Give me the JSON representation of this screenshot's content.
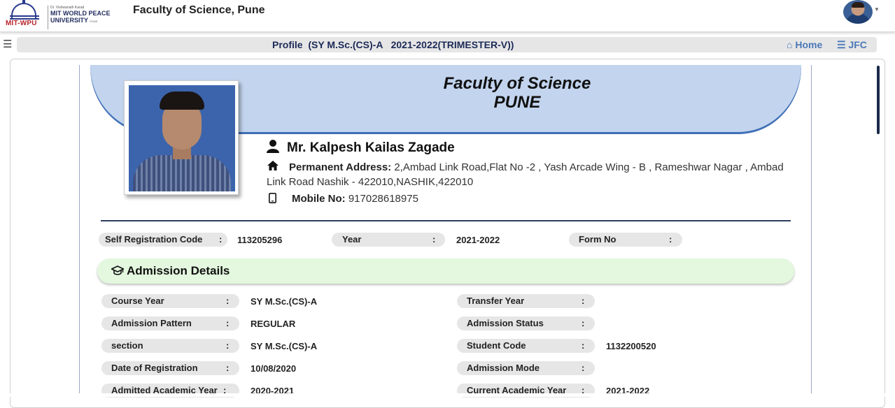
{
  "header": {
    "logo": {
      "left_text": "MIT-WPU",
      "small": "Dr. Vishwanath Karad",
      "name_line1": "MIT WORLD PEACE",
      "name_line2": "UNIVERSITY",
      "city": "PUNE"
    },
    "site_title": "Faculty of Science, Pune"
  },
  "subbar": {
    "title": "Profile  (SY M.Sc.(CS)-A   2021-2022(TRIMESTER-V))",
    "home_label": "Home",
    "jfc_label": "JFC"
  },
  "banner": {
    "line1": "Faculty of Science",
    "line2": "PUNE"
  },
  "profile": {
    "name": "Mr. Kalpesh Kailas Zagade",
    "address_label": "Permanent Address:",
    "address_value": " 2,Ambad Link Road,Flat No -2 , Yash Arcade Wing - B , Rameshwar Nagar , Ambad Link Road Nashik - 422010,NASHIK,422010",
    "mobile_label": "Mobile No:",
    "mobile_value": " 917028618975"
  },
  "registration": {
    "self_reg_label": "Self Registration Code",
    "self_reg_value": "113205296",
    "year_label": "Year",
    "year_value": "2021-2022",
    "form_label": "Form No",
    "form_value": ""
  },
  "admission": {
    "section_title": "Admission Details",
    "left": [
      {
        "label": "Course Year",
        "value": "SY M.Sc.(CS)-A"
      },
      {
        "label": "Admission Pattern",
        "value": "REGULAR"
      },
      {
        "label": "section",
        "value": "SY M.Sc.(CS)-A"
      },
      {
        "label": "Date of Registration",
        "value": "10/08/2020"
      },
      {
        "label": "Admitted Academic Year",
        "value": "2020-2021"
      }
    ],
    "right": [
      {
        "label": "Transfer Year",
        "value": ""
      },
      {
        "label": "Admission Status",
        "value": ""
      },
      {
        "label": "Student Code",
        "value": "1132200520"
      },
      {
        "label": "Admission Mode",
        "value": ""
      },
      {
        "label": "Current Academic Year",
        "value": "2021-2022"
      }
    ]
  },
  "colon": ":"
}
